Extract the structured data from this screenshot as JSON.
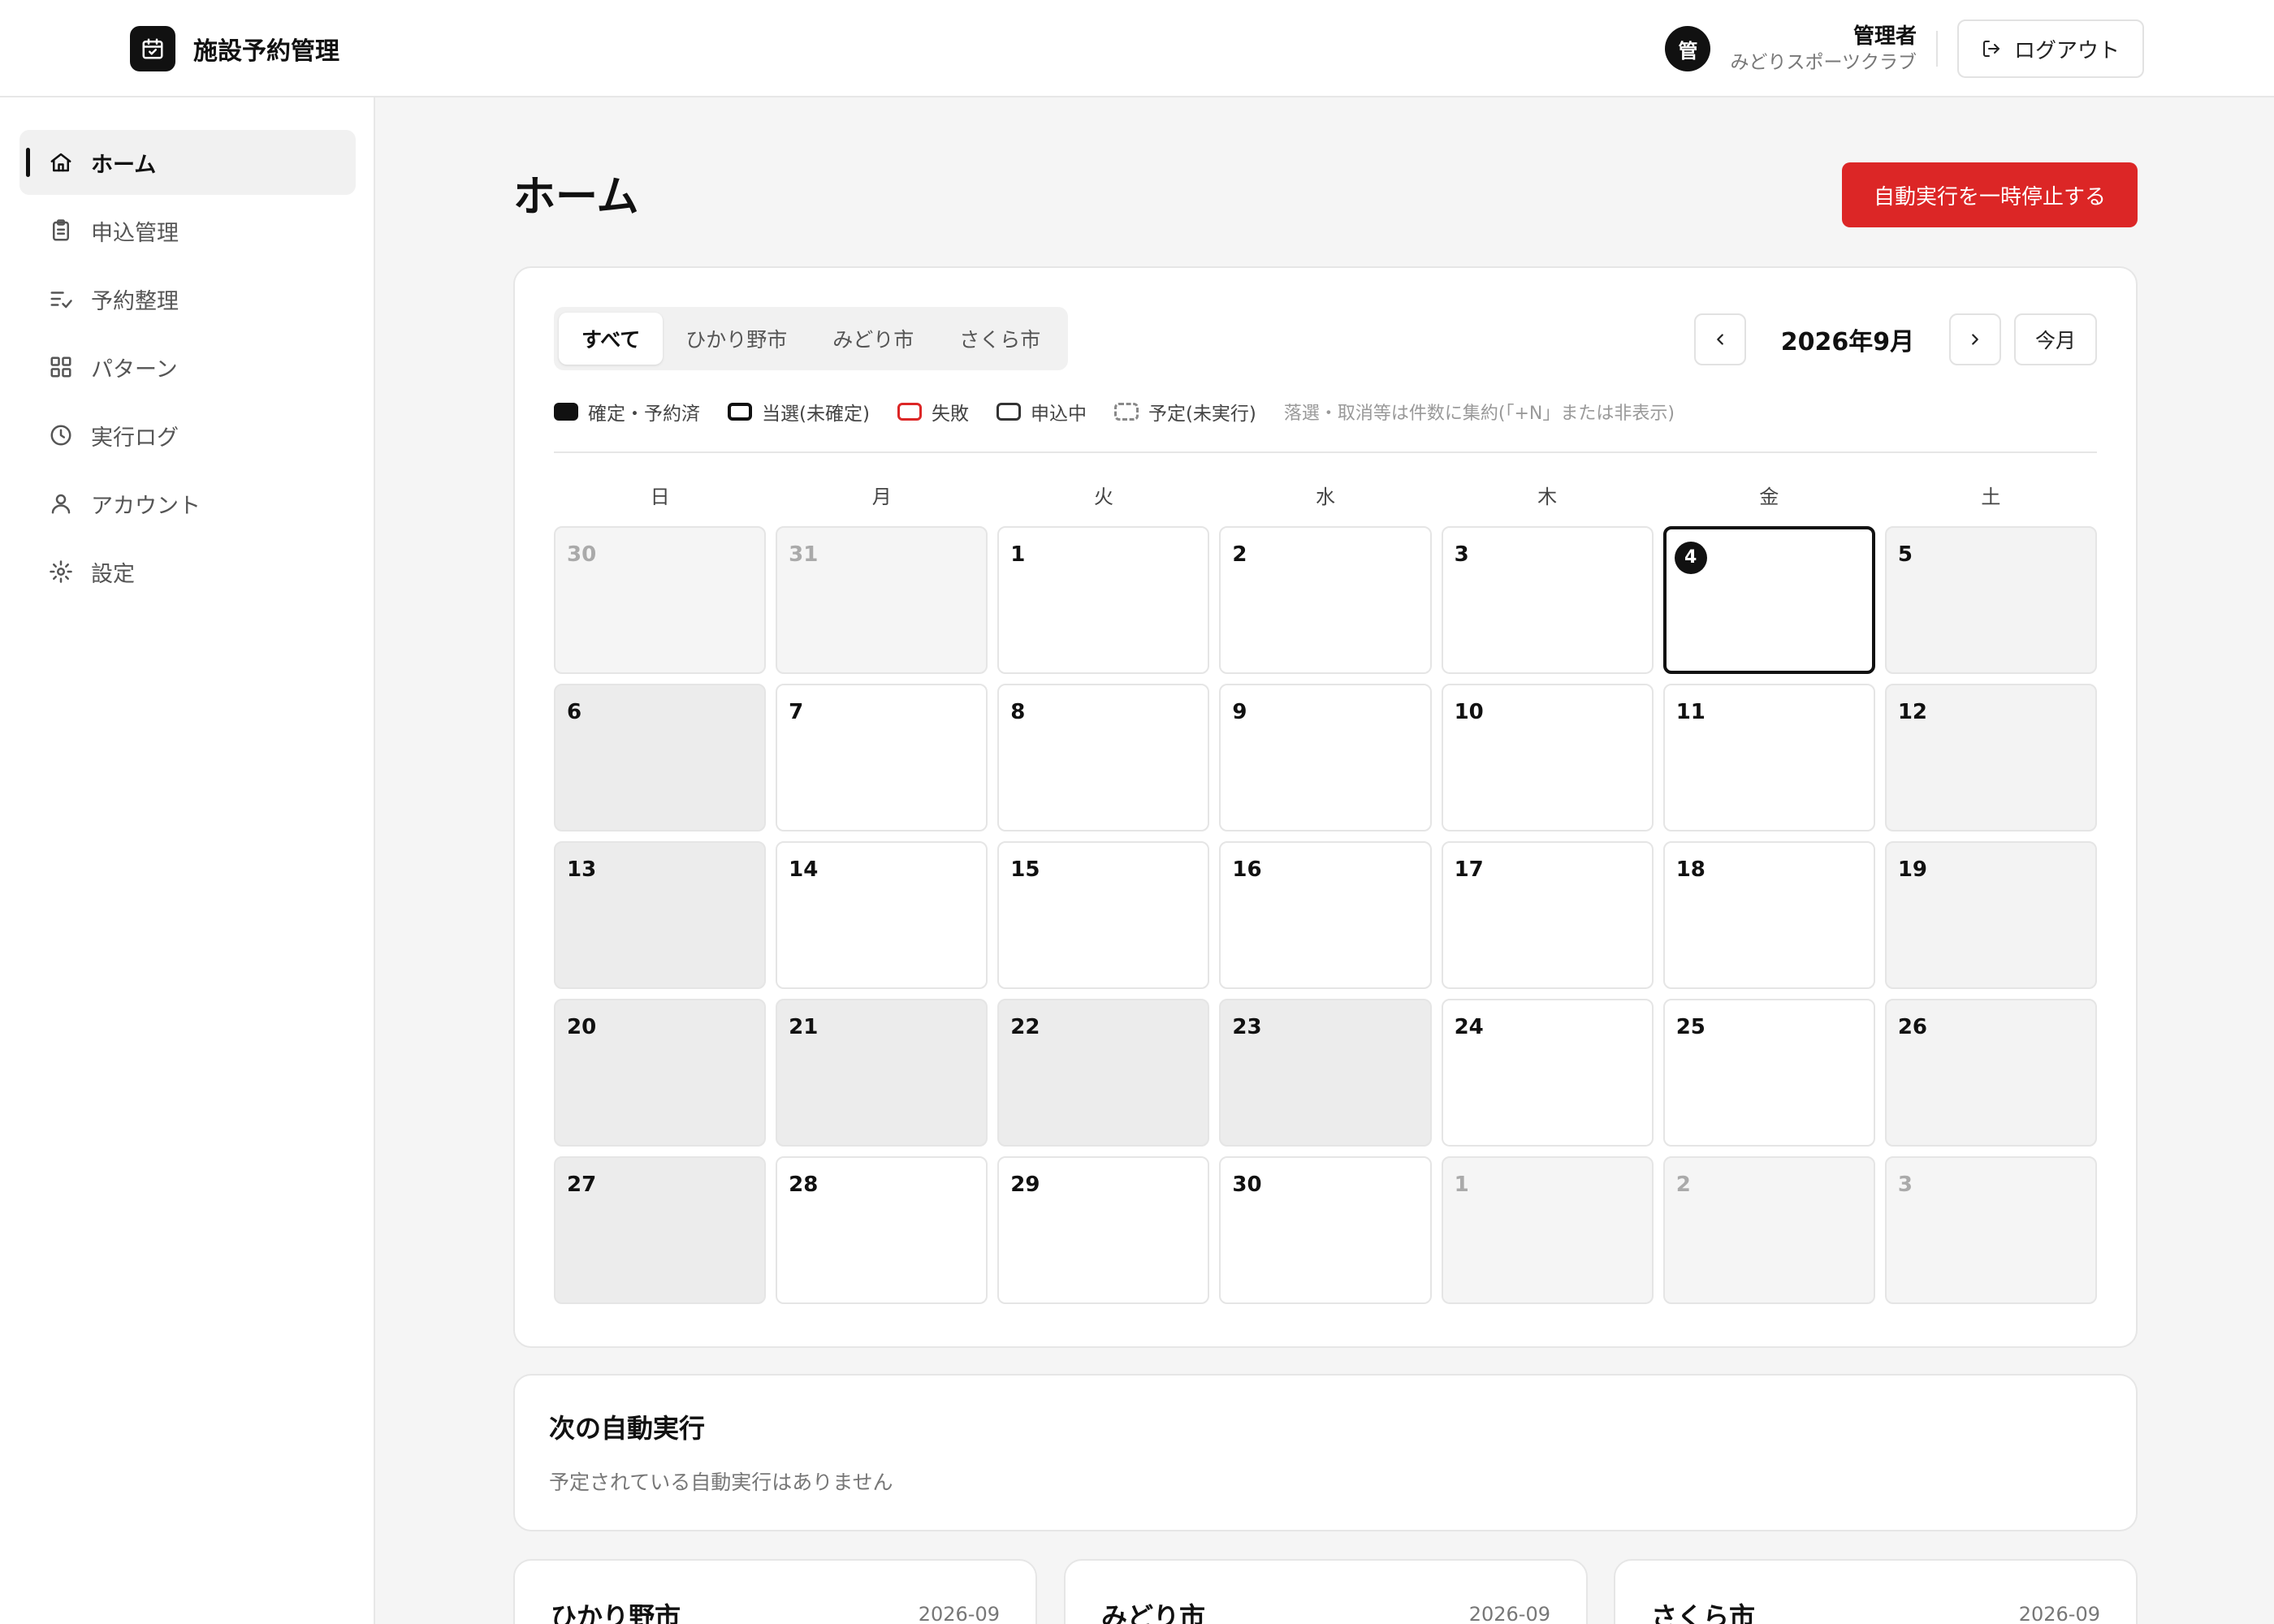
{
  "brand": {
    "title": "施設予約管理",
    "icon": "calendar-check-icon"
  },
  "user": {
    "avatar": "管",
    "name": "管理者",
    "org": "みどりスポーツクラブ",
    "logout_label": "ログアウト"
  },
  "sidebar": {
    "items": [
      {
        "label": "ホーム",
        "icon": "home-icon",
        "active": true
      },
      {
        "label": "申込管理",
        "icon": "clipboard-icon",
        "active": false
      },
      {
        "label": "予約整理",
        "icon": "list-check-icon",
        "active": false
      },
      {
        "label": "パターン",
        "icon": "grid-icon",
        "active": false
      },
      {
        "label": "実行ログ",
        "icon": "clock-icon",
        "active": false
      },
      {
        "label": "アカウント",
        "icon": "user-icon",
        "active": false
      },
      {
        "label": "設定",
        "icon": "gear-icon",
        "active": false
      }
    ]
  },
  "main": {
    "title": "ホーム",
    "pause_button": "自動実行を一時停止する",
    "accent_color": "#dc2626"
  },
  "calendar": {
    "tabs": [
      {
        "label": "すべて",
        "active": true
      },
      {
        "label": "ひかり野市",
        "active": false
      },
      {
        "label": "みどり市",
        "active": false
      },
      {
        "label": "さくら市",
        "active": false
      }
    ],
    "month_label": "2026年9月",
    "today_label": "今月",
    "legend": [
      {
        "label": "確定・予約済",
        "style": "confirmed"
      },
      {
        "label": "当選(未確定)",
        "style": "won"
      },
      {
        "label": "失敗",
        "style": "failed"
      },
      {
        "label": "申込中",
        "style": "applying"
      },
      {
        "label": "予定(未実行)",
        "style": "planned"
      }
    ],
    "legend_note": "落選・取消等は件数に集約(「+N」または非表示)",
    "weekdays": [
      "日",
      "月",
      "火",
      "水",
      "木",
      "金",
      "土"
    ],
    "days": [
      {
        "d": "30",
        "t": "off"
      },
      {
        "d": "31",
        "t": "off"
      },
      {
        "d": "1",
        "t": ""
      },
      {
        "d": "2",
        "t": ""
      },
      {
        "d": "3",
        "t": ""
      },
      {
        "d": "4",
        "t": "today"
      },
      {
        "d": "5",
        "t": "sat"
      },
      {
        "d": "6",
        "t": "weekend"
      },
      {
        "d": "7",
        "t": ""
      },
      {
        "d": "8",
        "t": ""
      },
      {
        "d": "9",
        "t": ""
      },
      {
        "d": "10",
        "t": ""
      },
      {
        "d": "11",
        "t": ""
      },
      {
        "d": "12",
        "t": "sat"
      },
      {
        "d": "13",
        "t": "weekend"
      },
      {
        "d": "14",
        "t": ""
      },
      {
        "d": "15",
        "t": ""
      },
      {
        "d": "16",
        "t": ""
      },
      {
        "d": "17",
        "t": ""
      },
      {
        "d": "18",
        "t": ""
      },
      {
        "d": "19",
        "t": "sat"
      },
      {
        "d": "20",
        "t": "weekend"
      },
      {
        "d": "21",
        "t": "holiday"
      },
      {
        "d": "22",
        "t": "holiday"
      },
      {
        "d": "23",
        "t": "holiday"
      },
      {
        "d": "24",
        "t": ""
      },
      {
        "d": "25",
        "t": ""
      },
      {
        "d": "26",
        "t": "sat"
      },
      {
        "d": "27",
        "t": "weekend"
      },
      {
        "d": "28",
        "t": ""
      },
      {
        "d": "29",
        "t": ""
      },
      {
        "d": "30",
        "t": ""
      },
      {
        "d": "1",
        "t": "off"
      },
      {
        "d": "2",
        "t": "off"
      },
      {
        "d": "3",
        "t": "off"
      }
    ]
  },
  "next_run": {
    "title": "次の自動実行",
    "empty_text": "予定されている自動実行はありません"
  },
  "cities": [
    {
      "name": "ひかり野市",
      "month": "2026-09"
    },
    {
      "name": "みどり市",
      "month": "2026-09"
    },
    {
      "name": "さくら市",
      "month": "2026-09"
    }
  ]
}
